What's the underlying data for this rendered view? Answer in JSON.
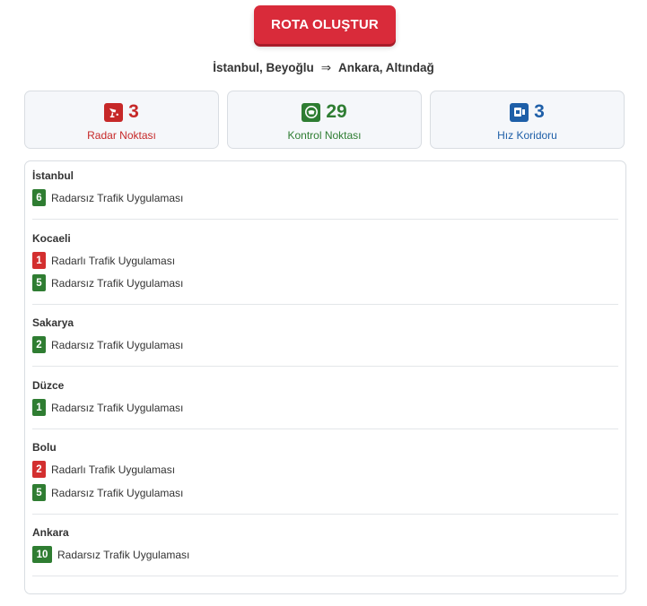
{
  "header": {
    "button_label": "ROTA OLUŞTUR",
    "route_from": "İstanbul, Beyoğlu",
    "route_arrow": "⇒",
    "route_to": "Ankara, Altındağ"
  },
  "stats": [
    {
      "value": "3",
      "label": "Radar Noktası",
      "color": "#c62828",
      "icon": "radar-camera-icon"
    },
    {
      "value": "29",
      "label": "Kontrol Noktası",
      "color": "#2e7d32",
      "icon": "police-checkpoint-icon"
    },
    {
      "value": "3",
      "label": "Hız Koridoru",
      "color": "#1e5fa8",
      "icon": "speed-corridor-icon"
    }
  ],
  "cities": [
    {
      "name": "İstanbul",
      "items": [
        {
          "count": "6",
          "text": "Radarsız Trafik Uygulaması",
          "color": "green"
        }
      ]
    },
    {
      "name": "Kocaeli",
      "items": [
        {
          "count": "1",
          "text": "Radarlı Trafik Uygulaması",
          "color": "red"
        },
        {
          "count": "5",
          "text": "Radarsız Trafik Uygulaması",
          "color": "green"
        }
      ]
    },
    {
      "name": "Sakarya",
      "items": [
        {
          "count": "2",
          "text": "Radarsız Trafik Uygulaması",
          "color": "green"
        }
      ]
    },
    {
      "name": "Düzce",
      "items": [
        {
          "count": "1",
          "text": "Radarsız Trafik Uygulaması",
          "color": "green"
        }
      ]
    },
    {
      "name": "Bolu",
      "items": [
        {
          "count": "2",
          "text": "Radarlı Trafik Uygulaması",
          "color": "red"
        },
        {
          "count": "5",
          "text": "Radarsız Trafik Uygulaması",
          "color": "green"
        }
      ]
    },
    {
      "name": "Ankara",
      "items": [
        {
          "count": "10",
          "text": "Radarsız Trafik Uygulaması",
          "color": "green"
        }
      ]
    }
  ]
}
